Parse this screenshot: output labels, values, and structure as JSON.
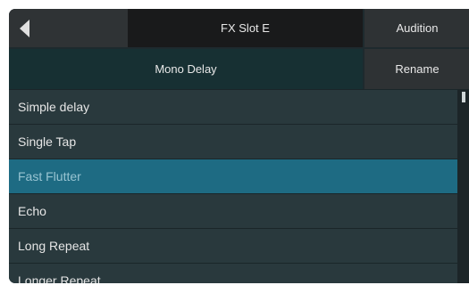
{
  "header": {
    "back_icon": "back-triangle-icon",
    "slot_title": "FX Slot E",
    "audition_label": "Audition"
  },
  "preset": {
    "name": "Mono Delay",
    "rename_label": "Rename"
  },
  "presets": [
    {
      "label": "Simple delay",
      "selected": false
    },
    {
      "label": "Single Tap",
      "selected": false
    },
    {
      "label": "Fast Flutter",
      "selected": true
    },
    {
      "label": "Echo",
      "selected": false
    },
    {
      "label": "Long Repeat",
      "selected": false
    },
    {
      "label": "Longer Repeat",
      "selected": false
    }
  ],
  "colors": {
    "panel": "#29393d",
    "selected": "#1e6b83",
    "title_bar": "#191a1b",
    "button": "#2e3234"
  }
}
